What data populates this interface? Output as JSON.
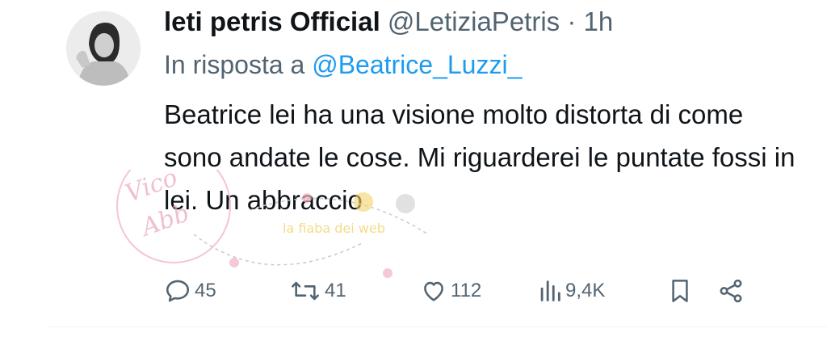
{
  "tweet": {
    "display_name": "leti petris Official",
    "handle": "@LetiziaPetris",
    "separator": "·",
    "time": "1h",
    "reply_prefix": "In risposta a",
    "reply_to": "@Beatrice_Luzzi_",
    "text": "Beatrice lei ha una visione molto distorta di come sono andate le cose. Mi riguarderei le puntate fossi in lei. Un abbraccio"
  },
  "actions": {
    "replies": "45",
    "retweets": "41",
    "likes": "112",
    "views": "9,4K"
  },
  "icons": [
    "reply-icon",
    "retweet-icon",
    "like-icon",
    "views-icon",
    "bookmark-icon",
    "share-icon"
  ],
  "colors": {
    "text": "#0f1419",
    "muted": "#536471",
    "link": "#1d9bf0"
  }
}
